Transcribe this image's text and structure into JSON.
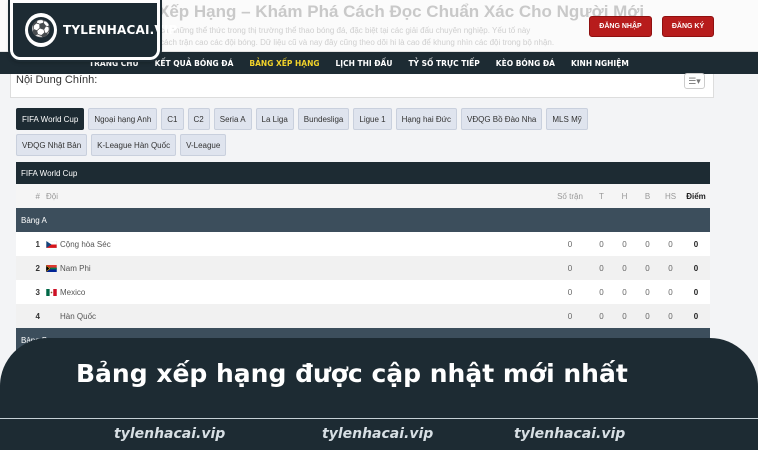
{
  "header": {
    "logo_text": "TYLENHACAI.VIP",
    "ghost_title": "Xếp Hạng – Khám Phá Cách Đọc Chuẩn Xác Cho Người Mới",
    "ghost_line_1": "cả những thể thức trong thị trường thể thao bóng đá, đặc biệt tại các giải đấu chuyên nghiệp. Yếu tố này",
    "ghost_line_2": "cách trận cao các đội bóng. Dữ liệu cũ và nay đây cũng theo dõi hi là cao để khung nhìn các đội trong bộ nhận.",
    "login_label": "ĐĂNG NHẬP",
    "register_label": "ĐĂNG KÝ"
  },
  "nav": {
    "items": [
      "TRANG CHỦ",
      "KẾT QUẢ BÓNG ĐÁ",
      "BẢNG XẾP HẠNG",
      "LỊCH THI ĐẤU",
      "TỶ SỐ TRỰC TIẾP",
      "KÈO BÓNG ĐÁ",
      "KINH NGHIỆM"
    ],
    "active_index": 2
  },
  "content": {
    "title": "Nội Dung Chính:"
  },
  "tabs": {
    "items": [
      "FIFA World Cup",
      "Ngoại hạng Anh",
      "C1",
      "C2",
      "Seria A",
      "La Liga",
      "Bundesliga",
      "Ligue 1",
      "Hạng hai Đức",
      "VĐQG Bồ Đào Nha",
      "MLS Mỹ",
      "VĐQG Nhật Bản",
      "K-League Hàn Quốc",
      "V-League"
    ],
    "active_index": 0
  },
  "standings": {
    "caption": "FIFA World Cup",
    "headers": {
      "rank": "#",
      "team": "Đội",
      "played": "Số trận",
      "w": "T",
      "d": "H",
      "l": "B",
      "gd": "HS",
      "pts": "Điểm"
    },
    "group_a_label": "Bảng A",
    "group_b_label": "Bảng B",
    "rows": [
      {
        "rank": "1",
        "team": "Cộng hòa Séc",
        "flag": "czech",
        "played": "0",
        "w": "0",
        "d": "0",
        "l": "0",
        "gd": "0",
        "pts": "0"
      },
      {
        "rank": "2",
        "team": "Nam Phi",
        "flag": "south-africa",
        "played": "0",
        "w": "0",
        "d": "0",
        "l": "0",
        "gd": "0",
        "pts": "0"
      },
      {
        "rank": "3",
        "team": "Mexico",
        "flag": "mexico",
        "played": "0",
        "w": "0",
        "d": "0",
        "l": "0",
        "gd": "0",
        "pts": "0"
      },
      {
        "rank": "4",
        "team": "Hàn Quốc",
        "flag": "none",
        "played": "0",
        "w": "0",
        "d": "0",
        "l": "0",
        "gd": "0",
        "pts": "0"
      }
    ]
  },
  "banner": {
    "headline": "Bảng xếp hạng được cập nhật mới nhất",
    "watermarks": [
      "tylenhacai.vip",
      "tylenhacai.vip",
      "tylenhacai.vip"
    ]
  },
  "colors": {
    "primary_dark": "#1d2b33",
    "accent_yellow": "#f2d32a",
    "button_red": "#b71c1c",
    "group_row": "#3c4e5c"
  }
}
